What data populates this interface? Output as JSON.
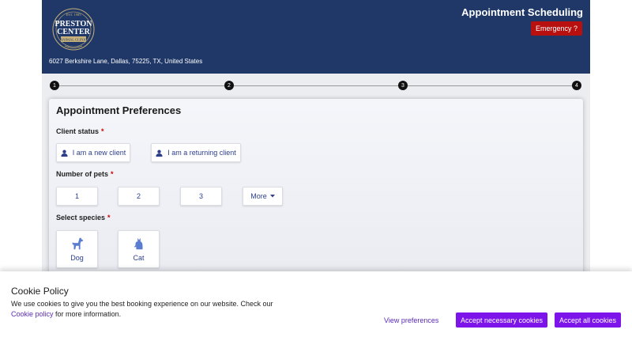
{
  "header": {
    "logo_text": [
      "EST. 1985",
      "PRESTON",
      "CENTER",
      "ANIMAL CLINIC"
    ],
    "address": "6027 Berkshire Lane, Dallas, 75225, TX, United States",
    "title": "Appointment Scheduling",
    "emergency_label": "Emergency ?"
  },
  "stepper": {
    "steps": [
      "1",
      "2",
      "3",
      "4"
    ]
  },
  "form": {
    "title": "Appointment Preferences",
    "client_status": {
      "label": "Client status",
      "required_mark": "*",
      "options": [
        "I am a new client",
        "I am a returning client"
      ]
    },
    "pets": {
      "label": "Number of pets",
      "required_mark": "*",
      "options": [
        "1",
        "2",
        "3"
      ],
      "more_label": "More"
    },
    "species": {
      "label": "Select species",
      "required_mark": "*",
      "options": [
        {
          "label": "Dog",
          "icon": "dog-icon"
        },
        {
          "label": "Cat",
          "icon": "cat-icon"
        }
      ]
    }
  },
  "cookie": {
    "title": "Cookie Policy",
    "text_before": "We use cookies to give you the best booking experience on our website. Check our",
    "link_text": "Cookie policy",
    "text_after": "for more information.",
    "view_preferences": "View preferences",
    "accept_necessary": "Accept necessary cookies",
    "accept_all": "Accept all cookies"
  },
  "colors": {
    "header_bg": "#1f3868",
    "emergency": "#b80f0f",
    "accent_purple": "#7d14ea",
    "option_text": "#2c3e8a"
  }
}
